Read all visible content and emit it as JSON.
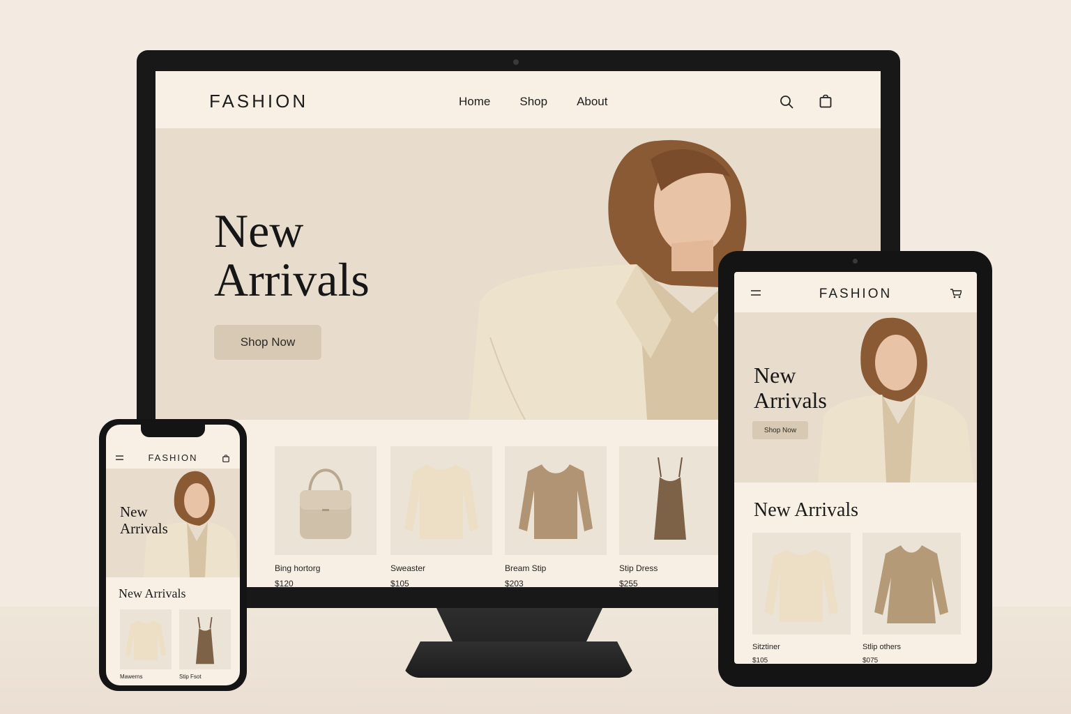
{
  "brand": "FASHION",
  "desktop": {
    "nav": [
      "Home",
      "Shop",
      "About"
    ],
    "hero_title_line1": "New",
    "hero_title_line2": "Arrivals",
    "cta": "Shop Now",
    "products": [
      {
        "name": "Bing hortorg",
        "price": "$120",
        "icon": "handbag-icon"
      },
      {
        "name": "Sweaster",
        "price": "$105",
        "icon": "sweater-icon"
      },
      {
        "name": "Bream Stip",
        "price": "$203",
        "icon": "sweater-icon"
      },
      {
        "name": "Stip Dress",
        "price": "$255",
        "icon": "slip-dress-icon"
      }
    ]
  },
  "tablet": {
    "hero_title_line1": "New",
    "hero_title_line2": "Arrivals",
    "cta": "Shop Now",
    "section_title": "New Arrivals",
    "products": [
      {
        "name": "Sitztiner",
        "price": "$105",
        "icon": "sweater-icon"
      },
      {
        "name": "Stlip others",
        "price": "$075",
        "icon": "tunic-icon"
      }
    ]
  },
  "phone": {
    "hero_title_line1": "New",
    "hero_title_line2": "Arrivals",
    "section_title": "New Arrivals",
    "products": [
      {
        "name": "Mawerns",
        "icon": "sweater-icon"
      },
      {
        "name": "Stip Fsot",
        "icon": "slip-dress-icon"
      }
    ]
  },
  "colors": {
    "background": "#f3ebe1",
    "hero": "#e8dccd",
    "button": "#d8c9b4",
    "device_frame": "#181818"
  }
}
